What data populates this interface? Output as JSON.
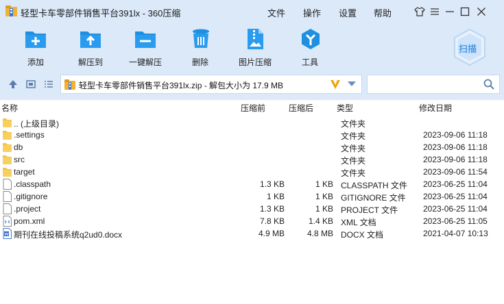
{
  "window": {
    "title": "轻型卡车零部件销售平台391lx - 360压缩",
    "menus": [
      "文件",
      "操作",
      "设置",
      "帮助"
    ]
  },
  "toolbar": {
    "items": [
      {
        "label": "添加",
        "icon": "add-icon"
      },
      {
        "label": "解压到",
        "icon": "extract-to-icon"
      },
      {
        "label": "一键解压",
        "icon": "one-click-extract-icon"
      },
      {
        "label": "删除",
        "icon": "trash-icon"
      },
      {
        "label": "图片压缩",
        "icon": "image-compress-icon"
      },
      {
        "label": "工具",
        "icon": "tools-icon"
      }
    ],
    "scan_label": "扫描"
  },
  "address": {
    "path": "轻型卡车零部件销售平台391lx.zip - 解包大小为 17.9 MB",
    "search_placeholder": ""
  },
  "columns": {
    "name": "名称",
    "size": "压缩前",
    "packed": "压缩后",
    "type": "类型",
    "modified": "修改日期"
  },
  "files": [
    {
      "name": ".. (上级目录)",
      "size": "",
      "packed": "",
      "type": "文件夹",
      "date": "",
      "kind": "folder"
    },
    {
      "name": ".settings",
      "size": "",
      "packed": "",
      "type": "文件夹",
      "date": "2023-09-06 11:18",
      "kind": "folder"
    },
    {
      "name": "db",
      "size": "",
      "packed": "",
      "type": "文件夹",
      "date": "2023-09-06 11:18",
      "kind": "folder"
    },
    {
      "name": "src",
      "size": "",
      "packed": "",
      "type": "文件夹",
      "date": "2023-09-06 11:18",
      "kind": "folder"
    },
    {
      "name": "target",
      "size": "",
      "packed": "",
      "type": "文件夹",
      "date": "2023-09-06 11:54",
      "kind": "folder"
    },
    {
      "name": ".classpath",
      "size": "1.3 KB",
      "packed": "1 KB",
      "type": "CLASSPATH 文件",
      "date": "2023-06-25 11:04",
      "kind": "file"
    },
    {
      "name": ".gitignore",
      "size": "1 KB",
      "packed": "1 KB",
      "type": "GITIGNORE 文件",
      "date": "2023-06-25 11:04",
      "kind": "file"
    },
    {
      "name": ".project",
      "size": "1.3 KB",
      "packed": "1 KB",
      "type": "PROJECT 文件",
      "date": "2023-06-25 11:04",
      "kind": "file"
    },
    {
      "name": "pom.xml",
      "size": "7.8 KB",
      "packed": "1.4 KB",
      "type": "XML 文档",
      "date": "2023-06-25 11:05",
      "kind": "xml"
    },
    {
      "name": "期刊在线投稿系统q2ud0.docx",
      "size": "4.9 MB",
      "packed": "4.8 MB",
      "type": "DOCX 文档",
      "date": "2021-04-07 10:13",
      "kind": "docx"
    }
  ],
  "colors": {
    "toolbar_bg": "#dbe9f9",
    "icon_blue": "#1f8fe0",
    "folder_yellow": "#f5c342"
  }
}
